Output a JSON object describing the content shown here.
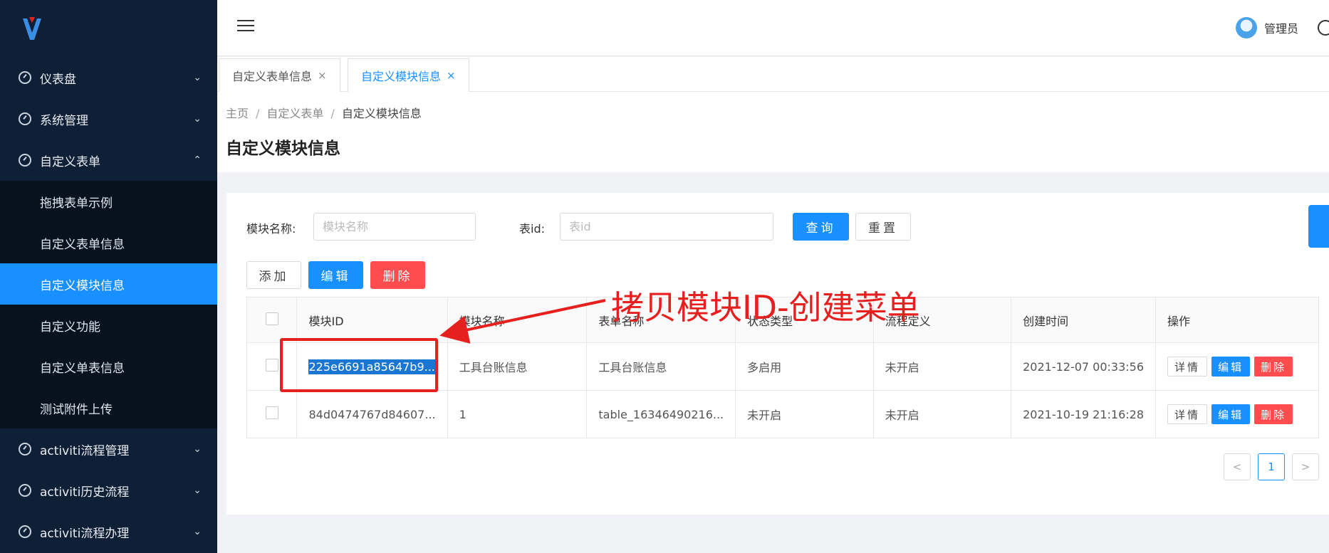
{
  "sidebar": {
    "items": [
      {
        "label": "仪表盘",
        "icon": "dashboard-icon",
        "expanded": false
      },
      {
        "label": "系统管理",
        "icon": "dashboard-icon",
        "expanded": false
      },
      {
        "label": "自定义表单",
        "icon": "dashboard-icon",
        "expanded": true
      }
    ],
    "subitems": [
      "拖拽表单示例",
      "自定义表单信息",
      "自定义模块信息",
      "自定义功能",
      "自定义单表信息",
      "测试附件上传"
    ],
    "active_subitem": "自定义模块信息",
    "bottom_items": [
      "activiti流程管理",
      "activiti历史流程",
      "activiti流程办理"
    ]
  },
  "header": {
    "user_name": "管理员"
  },
  "tabs": [
    {
      "label": "自定义表单信息",
      "active": false
    },
    {
      "label": "自定义模块信息",
      "active": true
    }
  ],
  "breadcrumb": [
    "主页",
    "自定义表单",
    "自定义模块信息"
  ],
  "page_title": "自定义模块信息",
  "search": {
    "module_name_label": "模块名称:",
    "module_name_placeholder": "模块名称",
    "table_id_label": "表id:",
    "table_id_placeholder": "表id",
    "query_label": "查询",
    "reset_label": "重置"
  },
  "toolbar": {
    "add_label": "添加",
    "edit_label": "编辑",
    "delete_label": "删除"
  },
  "table": {
    "columns": [
      "模块ID",
      "模块名称",
      "表单名称",
      "状态类型",
      "流程定义",
      "创建时间",
      "操作"
    ],
    "rows": [
      {
        "id": "225e6691a85647b9...",
        "module_name": "工具台账信息",
        "form_name": "工具台账信息",
        "status": "多启用",
        "flow": "未开启",
        "created": "2021-12-07 00:33:56"
      },
      {
        "id": "84d0474767d84607...",
        "module_name": "1",
        "form_name": "table_16346490216...",
        "status": "未开启",
        "flow": "未开启",
        "created": "2021-10-19 21:16:28"
      }
    ],
    "actions": {
      "detail": "详情",
      "edit": "编辑",
      "delete": "删除"
    }
  },
  "pagination": {
    "current": "1"
  },
  "annotation": {
    "text": "拷贝模块ID-创建菜单"
  },
  "colors": {
    "primary": "#1890ff",
    "danger": "#ff4d4f",
    "sidebar": "#0f1f35",
    "annotation": "#e5201f"
  }
}
